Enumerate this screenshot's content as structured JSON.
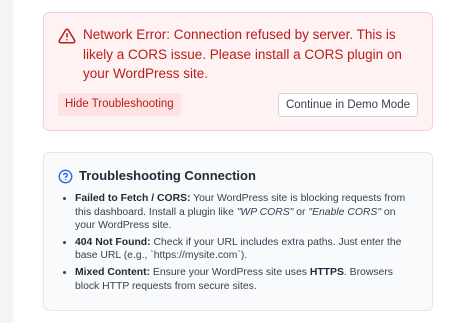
{
  "error": {
    "message": "Network Error: Connection refused by server. This is likely a CORS issue. Please install a CORS plugin on your WordPress site.",
    "hide_label": "Hide Troubleshooting",
    "demo_label": "Continue in Demo Mode",
    "icon": "alert-triangle-icon",
    "color": "#b91c1c"
  },
  "troubleshooting": {
    "title": "Troubleshooting Connection",
    "icon": "help-circle-icon",
    "accent": "#2563eb",
    "items": [
      {
        "label": "Failed to Fetch / CORS:",
        "text_1": " Your WordPress site is blocking requests from this dashboard. Install a plugin like ",
        "em_1": "\"WP CORS\"",
        "text_2": " or ",
        "em_2": "\"Enable CORS\"",
        "text_3": " on your WordPress site."
      },
      {
        "label": "404 Not Found:",
        "text_1": " Check if your URL includes extra paths. Just enter the base URL (e.g., `https://mysite.com`)."
      },
      {
        "label": "Mixed Content:",
        "text_1": " Ensure your WordPress site uses ",
        "strong": "HTTPS",
        "text_2": ". Browsers block HTTP requests from secure sites."
      }
    ]
  }
}
